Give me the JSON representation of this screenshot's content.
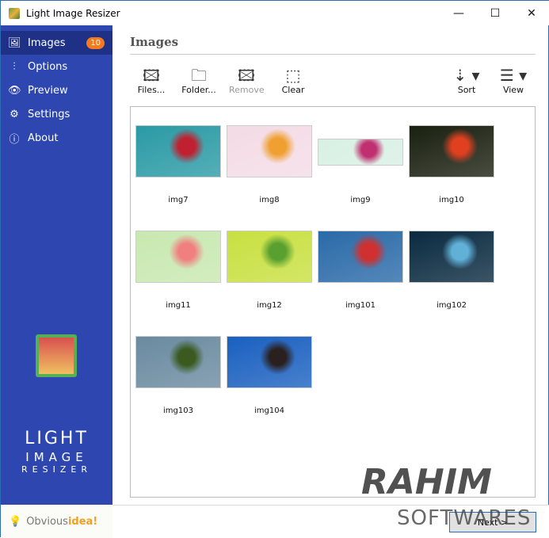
{
  "window": {
    "title": "Light Image Resizer",
    "minimize": "—",
    "maximize": "☐",
    "close": "✕"
  },
  "sidebar": {
    "items": [
      {
        "label": "Images",
        "icon": "🖼",
        "badge": "10"
      },
      {
        "label": "Options",
        "icon": "⫶"
      },
      {
        "label": "Preview",
        "icon": "👁"
      },
      {
        "label": "Settings",
        "icon": "⚙"
      },
      {
        "label": "About",
        "icon": "ⓘ"
      }
    ],
    "brand": {
      "line1": "LIGHT",
      "line2": "IMAGE",
      "line3": "RESIZER"
    },
    "vendor": {
      "part1": "Obvious",
      "part2": "idea!"
    }
  },
  "main": {
    "title": "Images",
    "toolbar": {
      "files": "Files...",
      "folder": "Folder...",
      "remove": "Remove",
      "clear": "Clear",
      "sort": "Sort",
      "view": "View"
    },
    "images": [
      {
        "name": "img7",
        "colors": [
          "#2a9aa5",
          "#c02030"
        ]
      },
      {
        "name": "img8",
        "colors": [
          "#f4dbe6",
          "#f0a030"
        ]
      },
      {
        "name": "img9",
        "colors": [
          "#d8f0e4",
          "#c03070"
        ]
      },
      {
        "name": "img10",
        "colors": [
          "#1a2010",
          "#e04020"
        ]
      },
      {
        "name": "img11",
        "colors": [
          "#c8e8b0",
          "#f08080"
        ]
      },
      {
        "name": "img12",
        "colors": [
          "#c8e040",
          "#5aa030"
        ]
      },
      {
        "name": "img101",
        "colors": [
          "#2a6aa8",
          "#d03030"
        ]
      },
      {
        "name": "img102",
        "colors": [
          "#0a2a40",
          "#60b0d8"
        ]
      },
      {
        "name": "img103",
        "colors": [
          "#6a8aa0",
          "#3a5a20"
        ]
      },
      {
        "name": "img104",
        "colors": [
          "#1a60c0",
          "#2a2020"
        ]
      }
    ]
  },
  "footer": {
    "next": "Next >"
  },
  "watermark": {
    "line1": "RAHIM",
    "line2": "SOFTWARES"
  }
}
